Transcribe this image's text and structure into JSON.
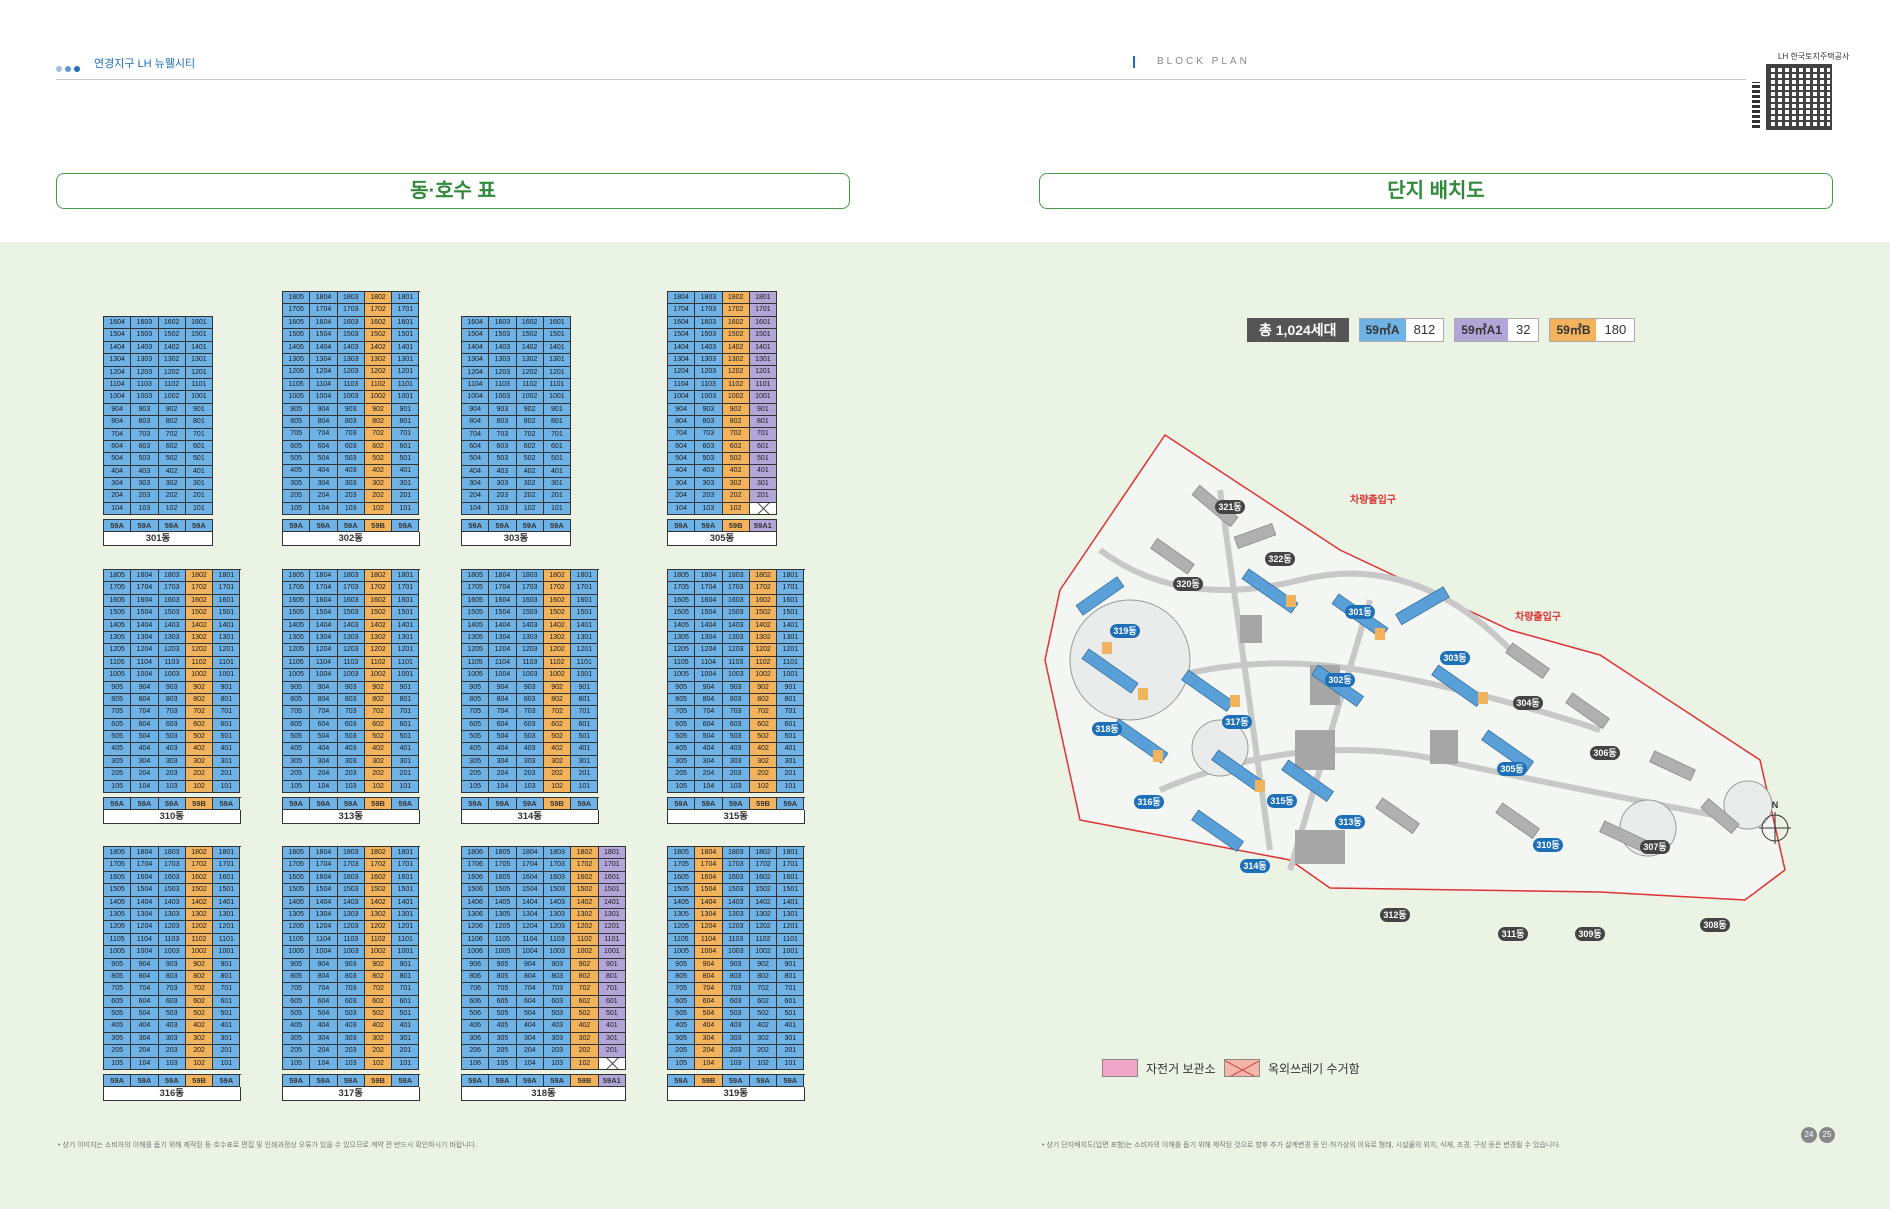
{
  "header": {
    "title": "연경지구 LH 뉴웰시티",
    "section": "BLOCK PLAN",
    "logo_text": "LH 한국토지주택공사"
  },
  "titles": {
    "left": "동·호수 표",
    "right": "단지 배치도"
  },
  "legend": {
    "total": "총 1,024세대",
    "items": [
      {
        "key": "59㎡A",
        "value": "812",
        "color": "#6fb2e6"
      },
      {
        "key": "59㎡A1",
        "value": "32",
        "color": "#b2a6d8"
      },
      {
        "key": "59㎡B",
        "value": "180",
        "color": "#f3b35c"
      }
    ]
  },
  "buildings": [
    {
      "name": "301동",
      "floors": 16,
      "lines": 4,
      "types": [
        "A",
        "A",
        "A",
        "A"
      ],
      "xfirst": false,
      "ended": 4
    },
    {
      "name": "302동",
      "floors": 18,
      "lines": 5,
      "types": [
        "A",
        "A",
        "A",
        "B",
        "A"
      ],
      "xfirst": false,
      "ended": 5
    },
    {
      "name": "303동",
      "floors": 16,
      "lines": 4,
      "types": [
        "A",
        "A",
        "A",
        "A"
      ],
      "xfirst": false,
      "ended": 4
    },
    {
      "name": "305동",
      "floors": 18,
      "lines": 4,
      "types": [
        "A",
        "A",
        "B",
        "A1"
      ],
      "xfirst": true,
      "ended": 4
    },
    {
      "name": "310동",
      "floors": 18,
      "lines": 5,
      "types": [
        "A",
        "A",
        "A",
        "B",
        "A"
      ],
      "xfirst": false,
      "ended": 5
    },
    {
      "name": "313동",
      "floors": 18,
      "lines": 5,
      "types": [
        "A",
        "A",
        "A",
        "B",
        "A"
      ],
      "xfirst": false,
      "ended": 5
    },
    {
      "name": "314동",
      "floors": 18,
      "lines": 5,
      "types": [
        "A",
        "A",
        "A",
        "B",
        "A"
      ],
      "xfirst": false,
      "ended": 5
    },
    {
      "name": "315동",
      "floors": 18,
      "lines": 5,
      "types": [
        "A",
        "A",
        "A",
        "B",
        "A"
      ],
      "xfirst": false,
      "ended": 5
    },
    {
      "name": "316동",
      "floors": 18,
      "lines": 5,
      "types": [
        "A",
        "A",
        "A",
        "B",
        "A"
      ],
      "xfirst": false,
      "ended": 5
    },
    {
      "name": "317동",
      "floors": 18,
      "lines": 5,
      "types": [
        "A",
        "A",
        "A",
        "B",
        "A"
      ],
      "xfirst": false,
      "ended": 5
    },
    {
      "name": "318동",
      "floors": 18,
      "lines": 6,
      "types": [
        "A",
        "A",
        "A",
        "A",
        "B",
        "A1"
      ],
      "xfirst": true,
      "ended": 6
    },
    {
      "name": "319동",
      "floors": 18,
      "lines": 5,
      "types": [
        "A",
        "B",
        "A",
        "A",
        "A"
      ],
      "xfirst": false,
      "ended": 5
    }
  ],
  "type_labels": {
    "A": "59A",
    "B": "59B",
    "A1": "59A1"
  },
  "site": {
    "entrances": [
      "차량출입구",
      "차량출입구"
    ],
    "compass": "N",
    "blocks_blue": [
      "301동",
      "302동",
      "303동",
      "305동",
      "310동",
      "313동",
      "314동",
      "315동",
      "316동",
      "317동",
      "318동",
      "319동"
    ],
    "blocks_dark": [
      "304동",
      "306동",
      "307동",
      "308동",
      "309동",
      "311동",
      "312동",
      "320동",
      "321동",
      "322동"
    ]
  },
  "bottom_legend": {
    "bike": "자전거 보관소",
    "trash": "옥외쓰레기 수거함"
  },
  "notes": {
    "left": "• 상기 이미지는 소비자의 이해를 돕기 위해 제작된 동·호수표로 편집 및 인쇄과정상 오류가 있을 수 있으므로 계약 전 반드시 확인하시기 바랍니다.",
    "right": "• 상기 단지배치도(입면 포함)는 소비자의 이해를 돕기 위해 제작된 것으로 향후 추가 설계변경 등 인·허가상의 이유로 형태, 시설물의 위치, 식재, 조경, 구성 등은 변경될 수 있습니다."
  },
  "page": [
    "24",
    "25"
  ]
}
